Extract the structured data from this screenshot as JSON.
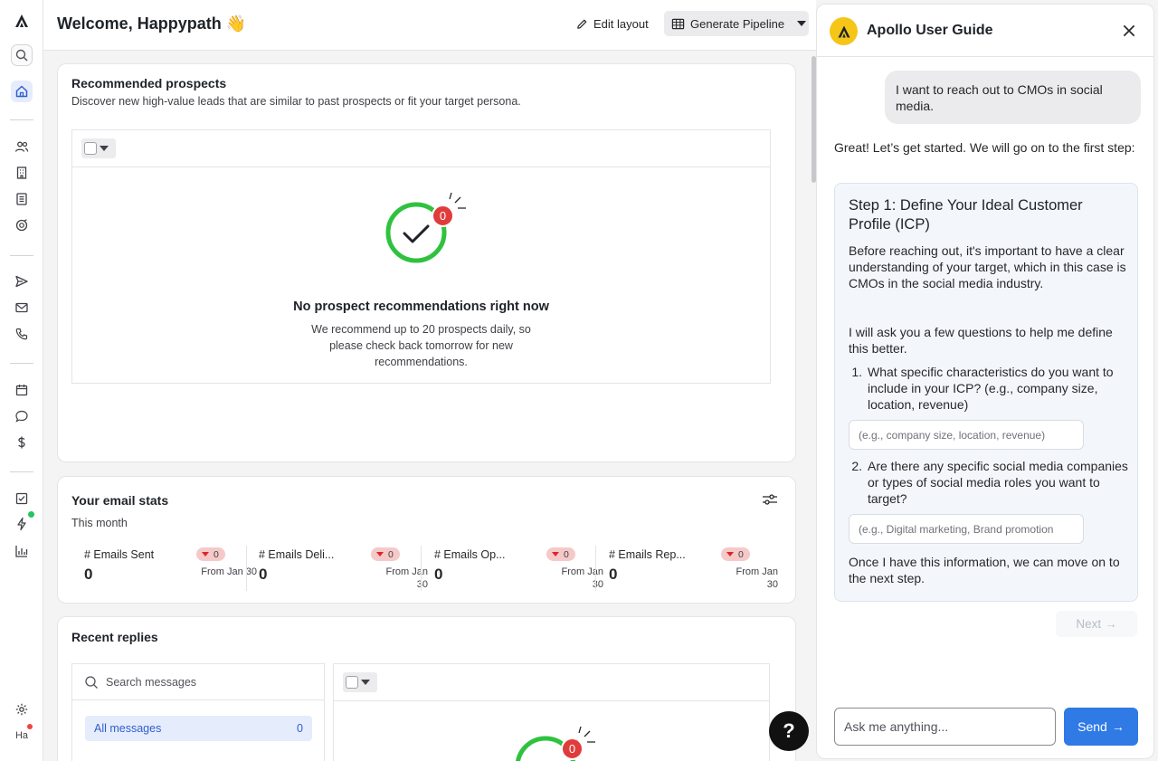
{
  "header": {
    "welcome": "Welcome, Happypath 👋",
    "edit_layout": "Edit layout",
    "generate_pipeline": "Generate Pipeline"
  },
  "sidebar": {
    "icons": [
      "apollo-logo-icon",
      "search-icon",
      "home-icon",
      "people-icon",
      "building-icon",
      "list-icon",
      "radar-icon",
      "send-icon",
      "mail-icon",
      "phone-icon",
      "calendar-icon",
      "chat-icon",
      "dollar-icon",
      "tasks-icon",
      "bolt-icon",
      "chart-icon",
      "gear-icon"
    ],
    "avatar_initials": "Ha"
  },
  "prospects": {
    "title": "Recommended prospects",
    "subtitle": "Discover new high-value leads that are similar to past prospects or fit your target persona.",
    "badge_count": "0",
    "empty_title": "No prospect recommendations right now",
    "empty_lines": [
      "We recommend up to 20 prospects daily, so",
      "please check back tomorrow for new",
      "recommendations."
    ]
  },
  "email_stats": {
    "title": "Your email stats",
    "period": "This month",
    "stats": [
      {
        "label": "# Emails Sent",
        "value": "0",
        "delta": "0",
        "from_1": "From Jan 30",
        "from_2": ""
      },
      {
        "label": "# Emails Deli...",
        "value": "0",
        "delta": "0",
        "from_1": "From Jan",
        "from_2": "30"
      },
      {
        "label": "# Emails Op...",
        "value": "0",
        "delta": "0",
        "from_1": "From Jan",
        "from_2": "30"
      },
      {
        "label": "# Emails Rep...",
        "value": "0",
        "delta": "0",
        "from_1": "From Jan",
        "from_2": "30"
      }
    ]
  },
  "replies": {
    "title": "Recent replies",
    "search_placeholder": "Search messages",
    "all_messages": "All messages",
    "all_messages_count": "0",
    "badge_count": "0"
  },
  "help_fab": "?",
  "guide": {
    "title": "Apollo User Guide",
    "user_message": "I want to reach out to CMOs in social media.",
    "assistant_intro": "Great! Let’s get started. We will go on to the first step:",
    "step_title": "Step 1: Define Your Ideal Customer Profile (ICP)",
    "step_para1": "Before reaching out, it's important to have a clear understanding of your target, which in this case is CMOs in the social media industry.",
    "step_para2": "I will ask you a few questions to help me define this better.",
    "q1": "What specific characteristics do you want to include in your ICP? (e.g., company size, location, revenue)",
    "q1_placeholder": "(e.g., company size, location, revenue)",
    "q2": "Are there any specific social media companies or types of social media roles you want to target?",
    "q2_placeholder": "(e.g., Digital marketing, Brand promotion",
    "step_outro": "Once I have this information, we can move on to the next step.",
    "next_label": "Next",
    "ask_placeholder": "Ask me anything...",
    "send_label": "Send"
  },
  "colors": {
    "accent": "#2f7ae5",
    "success_ring": "#2fc23f",
    "badge_red": "#e03c3c",
    "brand_yellow": "#f5c518"
  }
}
